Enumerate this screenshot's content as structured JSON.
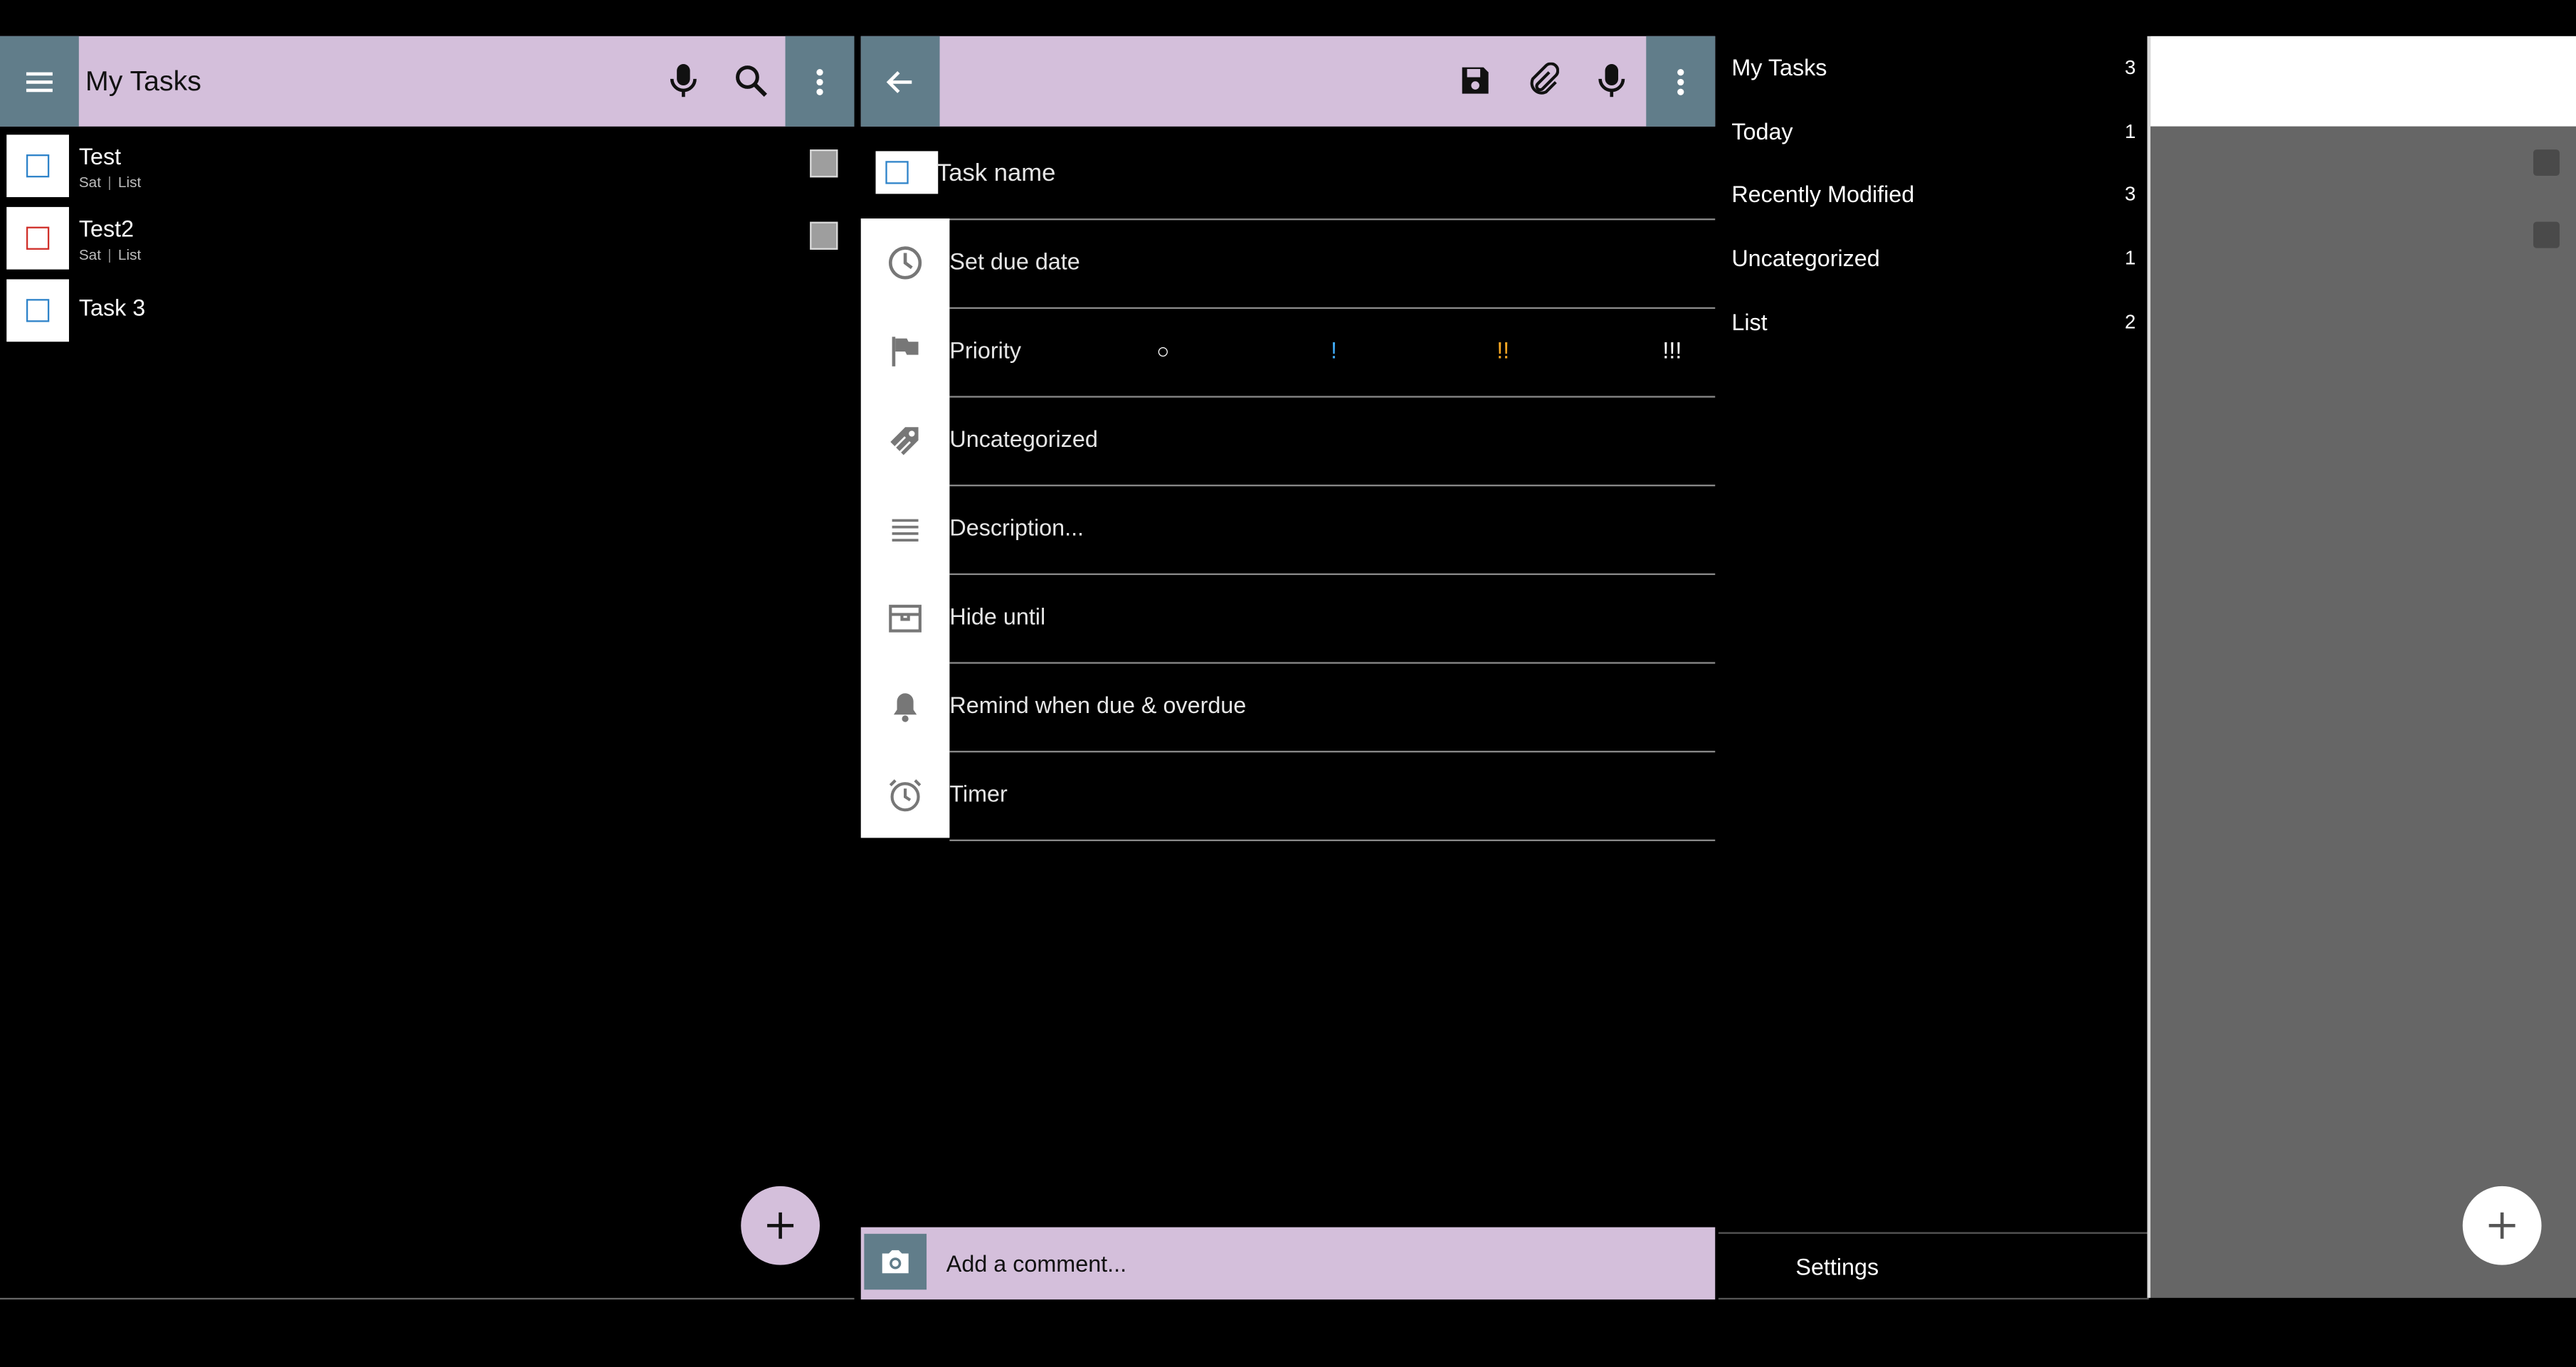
{
  "list_panel": {
    "title": "My Tasks",
    "tasks": [
      {
        "title": "Test",
        "day": "Sat",
        "list": "List"
      },
      {
        "title": "Test2",
        "day": "Sat",
        "list": "List"
      },
      {
        "title": "Task 3"
      }
    ]
  },
  "edit_panel": {
    "task_name_placeholder": "Task name",
    "due_date": "Set due date",
    "priority": {
      "label": "Priority",
      "levels": [
        "○",
        "!",
        "!!",
        "!!!"
      ]
    },
    "category": "Uncategorized",
    "description_placeholder": "Description...",
    "hide_until": "Hide until",
    "reminder": "Remind when due & overdue",
    "timer": "Timer",
    "comment_placeholder": "Add a comment..."
  },
  "drawer": {
    "items": [
      {
        "label": "My Tasks",
        "count": "3"
      },
      {
        "label": "Today",
        "count": "1"
      },
      {
        "label": "Recently Modified",
        "count": "3"
      },
      {
        "label": "Uncategorized",
        "count": "1"
      },
      {
        "label": "List",
        "count": "2"
      }
    ],
    "settings": "Settings"
  },
  "colors": {
    "toolbar": "#d4bfdb",
    "toolbar_button": "#617d8a",
    "priority_none": "#ffffff",
    "priority_low": "#3fa9f5",
    "priority_medium": "#f5a623",
    "priority_high": "#ffffff",
    "scrim": "#666666"
  }
}
